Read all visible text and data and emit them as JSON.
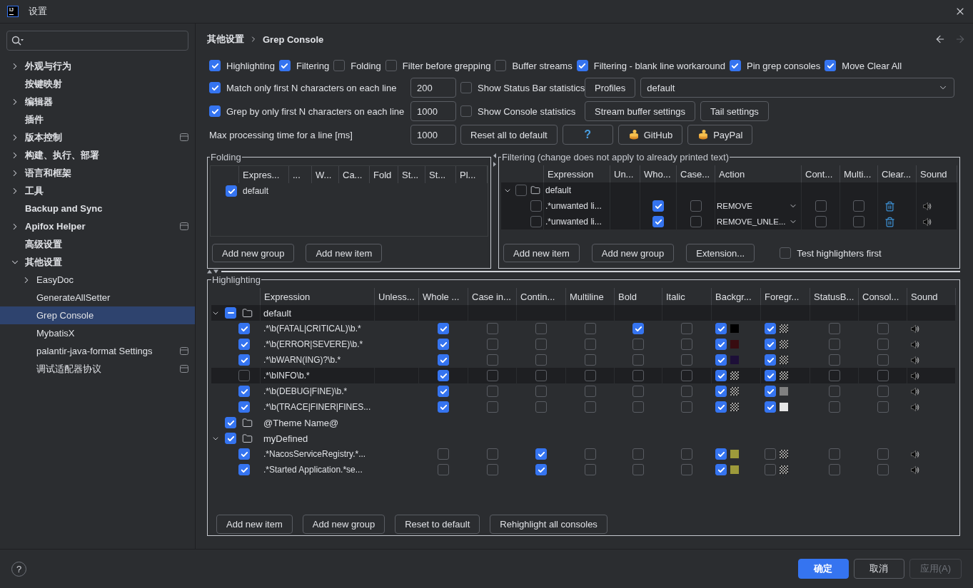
{
  "window": {
    "title": "设置",
    "logo": "IJ"
  },
  "sidebar": {
    "items": [
      {
        "label": "外观与行为",
        "expanded": false,
        "selected": false,
        "project_scope": false
      },
      {
        "label": "按键映射",
        "selected": false,
        "project_scope": false
      },
      {
        "label": "编辑器",
        "expanded": false,
        "selected": false,
        "project_scope": false
      },
      {
        "label": "插件",
        "selected": false,
        "project_scope": false
      },
      {
        "label": "版本控制",
        "expanded": false,
        "selected": false,
        "project_scope": true
      },
      {
        "label": "构建、执行、部署",
        "expanded": false,
        "selected": false,
        "project_scope": false
      },
      {
        "label": "语言和框架",
        "expanded": false,
        "selected": false,
        "project_scope": false
      },
      {
        "label": "工具",
        "expanded": false,
        "selected": false,
        "project_scope": false
      },
      {
        "label": "Backup and Sync",
        "selected": false,
        "project_scope": false
      },
      {
        "label": "Apifox Helper",
        "expanded": false,
        "selected": false,
        "project_scope": true
      },
      {
        "label": "高级设置",
        "selected": false,
        "project_scope": false
      },
      {
        "label": "其他设置",
        "expanded": true,
        "selected": false,
        "project_scope": false,
        "children": [
          {
            "label": "EasyDoc",
            "expanded": false,
            "selected": false,
            "project_scope": false
          },
          {
            "label": "GenerateAllSetter",
            "selected": false,
            "project_scope": false
          },
          {
            "label": "Grep Console",
            "selected": true,
            "project_scope": false
          },
          {
            "label": "MybatisX",
            "selected": false,
            "project_scope": false
          },
          {
            "label": "palantir-java-format Settings",
            "selected": false,
            "project_scope": true
          },
          {
            "label": "调试适配器协议",
            "selected": false,
            "project_scope": true
          }
        ]
      }
    ]
  },
  "header": {
    "breadcrumb": [
      "其他设置",
      "Grep Console"
    ],
    "back": {
      "disabled": false
    },
    "forward": {
      "disabled": true
    }
  },
  "options": {
    "flags": [
      {
        "label": "Highlighting",
        "checked": true
      },
      {
        "label": "Filtering",
        "checked": true
      },
      {
        "label": "Folding",
        "checked": false
      },
      {
        "label": "Filter before grepping",
        "checked": false
      },
      {
        "label": "Buffer streams",
        "checked": false
      },
      {
        "label": "Filtering - blank line workaround",
        "checked": true
      },
      {
        "label": "Pin grep consoles",
        "checked": true
      },
      {
        "label": "Move Clear All",
        "checked": true
      }
    ],
    "match_first_n": {
      "label": "Match only first N characters on each line",
      "checked": true,
      "value": "200"
    },
    "show_status_bar": {
      "label": "Show Status Bar statistics",
      "checked": false
    },
    "profiles_button": "Profiles",
    "profile": "default",
    "grep_first_n": {
      "label": "Grep by only first N characters on each line",
      "checked": true,
      "value": "1000"
    },
    "show_console": {
      "label": "Show Console statistics",
      "checked": false
    },
    "buffer_buttons": [
      "Stream buffer settings",
      "Tail settings"
    ],
    "max_processing": {
      "label": "Max processing time for a line [ms]",
      "value": "1000"
    },
    "reset_button": "Reset all to default",
    "help_button": "?",
    "donate_buttons": [
      "GitHub",
      "PayPal"
    ]
  },
  "folding": {
    "title": "Folding",
    "columns": [
      "Expres...",
      "...",
      "W...",
      "Ca...",
      "Fold",
      "St...",
      "St...",
      "Pl..."
    ],
    "rows": [
      {
        "name": "default",
        "checked": true
      }
    ],
    "buttons": [
      "Add new group",
      "Add new item"
    ]
  },
  "filtering": {
    "title": "Filtering (change does not apply to already printed text)",
    "columns": [
      "Expression",
      "Un...",
      "Who...",
      "Case...",
      "Action",
      "Cont...",
      "Multi...",
      "Clear...",
      "Sound"
    ],
    "rows": [
      {
        "name": "default",
        "expanded": true,
        "checked": false,
        "children": [
          {
            "expression": ".*unwanted li...",
            "enabled": false,
            "whole": true,
            "case": false,
            "action": "REMOVE",
            "continue": false,
            "multiline": false
          },
          {
            "expression": ".*unwanted li...",
            "enabled": false,
            "whole": true,
            "case": false,
            "action": "REMOVE_UNLE...",
            "continue": false,
            "multiline": false
          }
        ]
      }
    ],
    "buttons": [
      "Add new item",
      "Add new group",
      "Extension..."
    ],
    "test_highlighters": {
      "label": "Test highlighters first",
      "checked": false
    }
  },
  "highlighting": {
    "title": "Highlighting",
    "columns": [
      "Expression",
      "Unless...",
      "Whole ...",
      "Case in...",
      "Contin...",
      "Multiline",
      "Bold",
      "Italic",
      "Backgr...",
      "Foregr...",
      "StatusB...",
      "Consol...",
      "Sound"
    ],
    "rows": [
      {
        "name": "default",
        "expanded": true,
        "checked": true,
        "mixed": true,
        "children": [
          {
            "expression": ".*\\b(FATAL|CRITICAL)\\b.*",
            "enabled": true,
            "whole": true,
            "case": false,
            "continue": false,
            "multiline": false,
            "bold": true,
            "italic": false,
            "background": {
              "checked": true,
              "color": "#000000"
            },
            "foreground": {
              "checked": true
            },
            "status_bar": false,
            "console": false
          },
          {
            "expression": ".*\\b(ERROR|SEVERE)\\b.*",
            "enabled": true,
            "whole": true,
            "case": false,
            "continue": false,
            "multiline": false,
            "bold": false,
            "italic": false,
            "background": {
              "checked": true,
              "color": "#380c10"
            },
            "foreground": {
              "checked": true
            },
            "status_bar": false,
            "console": false
          },
          {
            "expression": ".*\\bWARN(ING)?\\b.*",
            "enabled": true,
            "whole": true,
            "case": false,
            "continue": false,
            "multiline": false,
            "bold": false,
            "italic": false,
            "background": {
              "checked": true,
              "color": "#1d0f38"
            },
            "foreground": {
              "checked": true
            },
            "status_bar": false,
            "console": false
          },
          {
            "expression": ".*\\bINFO\\b.*",
            "enabled": false,
            "whole": true,
            "case": false,
            "continue": false,
            "multiline": false,
            "bold": false,
            "italic": false,
            "background": {
              "checked": true
            },
            "foreground": {
              "checked": true
            },
            "status_bar": false,
            "console": false
          },
          {
            "expression": ".*\\b(DEBUG|FINE)\\b.*",
            "enabled": true,
            "whole": true,
            "case": false,
            "continue": false,
            "multiline": false,
            "bold": false,
            "italic": false,
            "background": {
              "checked": true
            },
            "foreground": {
              "checked": true,
              "color": "#808080"
            },
            "status_bar": false,
            "console": false
          },
          {
            "expression": ".*\\b(TRACE|FINER|FINES...",
            "enabled": true,
            "whole": true,
            "case": false,
            "continue": false,
            "multiline": false,
            "bold": false,
            "italic": false,
            "background": {
              "checked": true
            },
            "foreground": {
              "checked": true,
              "color": "#e6e6e6"
            },
            "status_bar": false,
            "console": false
          }
        ]
      },
      {
        "name": "@Theme Name@",
        "checked": true,
        "mixed": false
      },
      {
        "name": "myDefined",
        "expanded": true,
        "checked": true,
        "mixed": false,
        "children": [
          {
            "expression": ".*NacosServiceRegistry.*...",
            "enabled": true,
            "whole": false,
            "case": false,
            "continue": true,
            "multiline": false,
            "bold": false,
            "italic": false,
            "background": {
              "checked": true,
              "color": "#9d9a3b"
            },
            "foreground": {
              "checked": false
            },
            "status_bar": false,
            "console": false
          },
          {
            "expression": ".*Started Application.*se...",
            "enabled": true,
            "whole": false,
            "case": false,
            "continue": true,
            "multiline": false,
            "bold": false,
            "italic": false,
            "background": {
              "checked": true,
              "color": "#9d9a3b"
            },
            "foreground": {
              "checked": false
            },
            "status_bar": false,
            "console": false
          }
        ]
      }
    ],
    "buttons": [
      "Add new item",
      "Add new group",
      "Reset to default",
      "Rehighlight all consoles"
    ]
  },
  "footer": {
    "help": "?",
    "buttons": [
      {
        "label": "确定",
        "kind": "primary"
      },
      {
        "label": "取消",
        "kind": "default"
      },
      {
        "label": "应用(A)",
        "kind": "disabled"
      }
    ]
  }
}
